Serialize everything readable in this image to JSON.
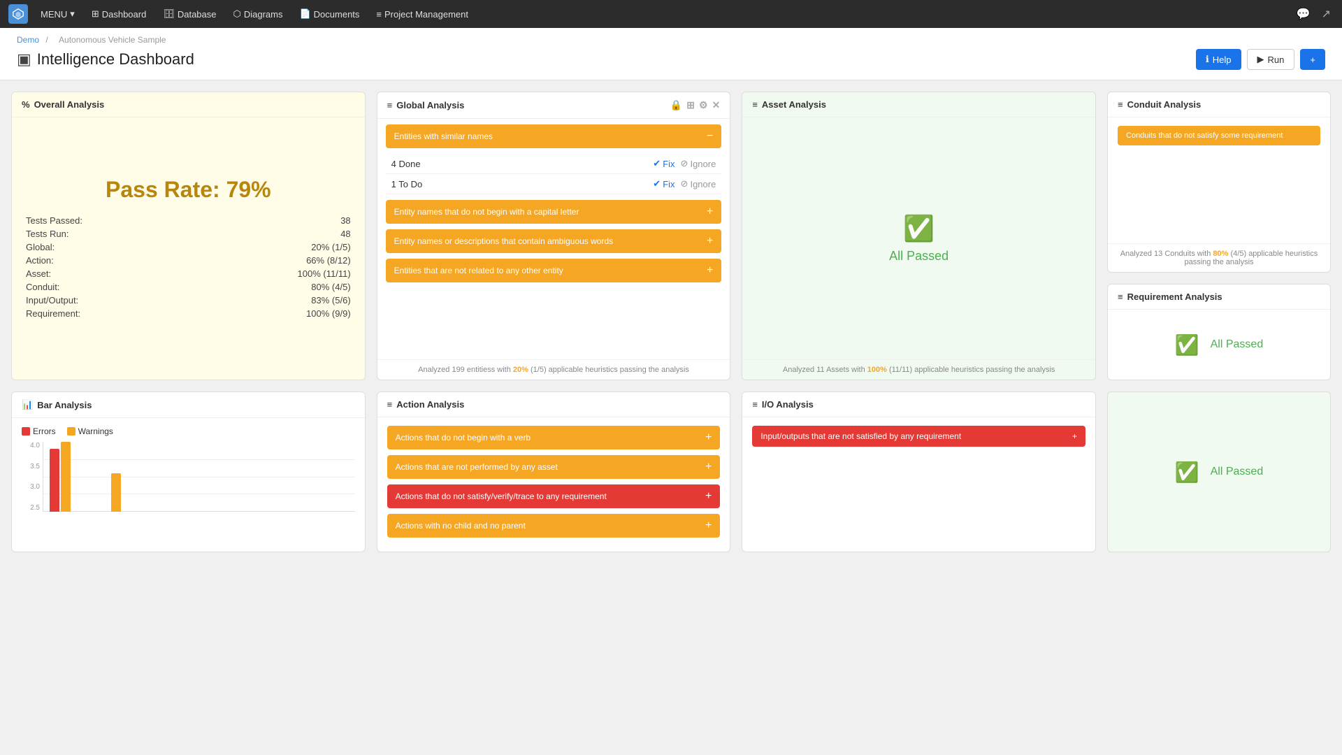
{
  "nav": {
    "menu_label": "MENU",
    "items": [
      {
        "label": "Dashboard",
        "icon": "⊞"
      },
      {
        "label": "Database",
        "icon": "🗄"
      },
      {
        "label": "Diagrams",
        "icon": "⬡"
      },
      {
        "label": "Documents",
        "icon": "📄"
      },
      {
        "label": "Project Management",
        "icon": "≡"
      }
    ]
  },
  "breadcrumb": {
    "root": "Demo",
    "child": "Autonomous Vehicle Sample"
  },
  "header": {
    "title": "Intelligence Dashboard",
    "help_label": "Help",
    "run_label": "Run",
    "add_label": "+"
  },
  "overall": {
    "title": "Overall Analysis",
    "pass_rate": "Pass Rate: 79%",
    "stats": [
      {
        "label": "Tests Passed:",
        "value": "38"
      },
      {
        "label": "Tests Run:",
        "value": "48"
      },
      {
        "label": "Global:",
        "value": "20% (1/5)"
      },
      {
        "label": "Action:",
        "value": "66% (8/12)"
      },
      {
        "label": "Asset:",
        "value": "100% (11/11)"
      },
      {
        "label": "Conduit:",
        "value": "80% (4/5)"
      },
      {
        "label": "Input/Output:",
        "value": "83% (5/6)"
      },
      {
        "label": "Requirement:",
        "value": "100% (9/9)"
      }
    ]
  },
  "global": {
    "title": "Global Analysis",
    "banners": [
      {
        "label": "Entities with similar names",
        "color": "warning",
        "expanded": true
      },
      {
        "label": "Entity names that do not begin with a capital letter",
        "color": "warning"
      },
      {
        "label": "Entity names or descriptions that contain ambiguous words",
        "color": "warning"
      },
      {
        "label": "Entities that are not related to any other entity",
        "color": "warning"
      }
    ],
    "rows": [
      {
        "label": "4 Done",
        "fix": "Fix",
        "ignore": "Ignore"
      },
      {
        "label": "1 To Do",
        "fix": "Fix",
        "ignore": "Ignore"
      }
    ],
    "footer": "Analyzed 199 entitiess with",
    "footer_highlight": "20%",
    "footer_rest": "(1/5) applicable heuristics passing the analysis"
  },
  "asset": {
    "title": "Asset Analysis",
    "all_passed": "All Passed",
    "footer": "Analyzed 11 Assets with",
    "footer_highlight": "100%",
    "footer_rest": "(11/11) applicable heuristics passing the analysis"
  },
  "conduit": {
    "title": "Conduit Analysis",
    "banner": "Conduits that do not satisfy some requirement",
    "footer": "Analyzed 13 Conduits with",
    "footer_highlight": "80%",
    "footer_rest": "(4/5) applicable heuristics passing the analysis"
  },
  "requirement": {
    "title": "Requirement Analysis",
    "all_passed": "All Passed"
  },
  "bar": {
    "title": "Bar Analysis",
    "legend": [
      {
        "label": "Errors",
        "color": "#e53935"
      },
      {
        "label": "Warnings",
        "color": "#f5a623"
      }
    ],
    "y_labels": [
      "4.0",
      "3.5",
      "3.0",
      "2.5"
    ],
    "bars": [
      {
        "error": 90,
        "warning": 100
      },
      {
        "error": 0,
        "warning": 0
      },
      {
        "error": 0,
        "warning": 55
      },
      {
        "error": 0,
        "warning": 0
      },
      {
        "error": 0,
        "warning": 0
      },
      {
        "error": 0,
        "warning": 0
      },
      {
        "error": 0,
        "warning": 0
      },
      {
        "error": 0,
        "warning": 0
      }
    ]
  },
  "action": {
    "title": "Action Analysis",
    "banners": [
      {
        "label": "Actions that do not begin with a verb",
        "color": "warning"
      },
      {
        "label": "Actions that are not performed by any asset",
        "color": "warning"
      },
      {
        "label": "Actions that do not satisfy/verify/trace to any requirement",
        "color": "red"
      },
      {
        "label": "Actions with no child and no parent",
        "color": "warning"
      }
    ]
  },
  "io": {
    "title": "I/O Analysis",
    "banner": "Input/outputs that are not satisfied by any requirement",
    "banner_color": "red"
  }
}
